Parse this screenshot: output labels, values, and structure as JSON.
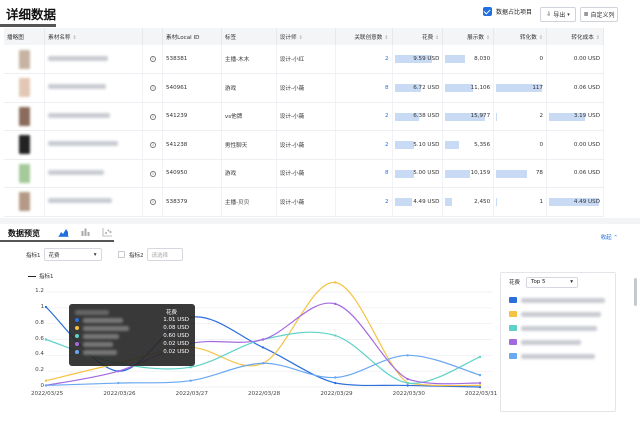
{
  "header": {
    "title": "详细数据"
  },
  "toolbar": {
    "toggle_label": "数据占比项目",
    "export_label": "导出",
    "custom_label": "自定义列"
  },
  "table": {
    "headers": [
      "播略图",
      "素材名称",
      "",
      "素材Local ID",
      "标签",
      "设计师",
      "关联创意数",
      "花费",
      "展示数",
      "转化数",
      "转化成本"
    ],
    "rows": [
      {
        "id": "538381",
        "tag": "主播-木木",
        "designer": "设计-小红",
        "creatives": "2",
        "cost": "9.59 USD",
        "impr": "8,030",
        "conv": "0",
        "cpa": "0.00 USD",
        "cost_frac": 0.85,
        "impr_frac": 0.45,
        "conv_frac": 0,
        "cpa_frac": 0,
        "thumb": "#c7b3a3"
      },
      {
        "id": "540961",
        "tag": "游戏",
        "designer": "设计-小薇",
        "creatives": "8",
        "cost": "6.72 USD",
        "impr": "11,106",
        "conv": "117",
        "cpa": "0.06 USD",
        "cost_frac": 0.6,
        "impr_frac": 0.62,
        "conv_frac": 1,
        "cpa_frac": 0,
        "thumb": "#e2c7b4"
      },
      {
        "id": "541239",
        "tag": "vs他牌",
        "designer": "设计-小薇",
        "creatives": "2",
        "cost": "6.38 USD",
        "impr": "15,977",
        "conv": "2",
        "cpa": "3.19 USD",
        "cost_frac": 0.56,
        "impr_frac": 0.9,
        "conv_frac": 0.02,
        "cpa_frac": 0.72,
        "thumb": "#8b6c5c"
      },
      {
        "id": "541238",
        "tag": "男性聊天",
        "designer": "设计-小薇",
        "creatives": "2",
        "cost": "5.10 USD",
        "impr": "5,356",
        "conv": "0",
        "cpa": "0.00 USD",
        "cost_frac": 0.45,
        "impr_frac": 0.3,
        "conv_frac": 0,
        "cpa_frac": 0,
        "thumb": "#222222"
      },
      {
        "id": "540950",
        "tag": "游戏",
        "designer": "设计-小薇",
        "creatives": "8",
        "cost": "5.00 USD",
        "impr": "10,159",
        "conv": "78",
        "cpa": "0.06 USD",
        "cost_frac": 0.44,
        "impr_frac": 0.57,
        "conv_frac": 0.67,
        "cpa_frac": 0,
        "thumb": "#a5c99a"
      },
      {
        "id": "538379",
        "tag": "主播-贝贝",
        "designer": "设计-小薇",
        "creatives": "2",
        "cost": "4.49 USD",
        "impr": "2,450",
        "conv": "1",
        "cpa": "4.49 USD",
        "cost_frac": 0.4,
        "impr_frac": 0.14,
        "conv_frac": 0.01,
        "cpa_frac": 1,
        "thumb": "#b49a86"
      }
    ]
  },
  "preview": {
    "title": "数据预览",
    "collapse_label": "收起",
    "metric1_label": "指标1",
    "metric1_value": "花费",
    "metric2_label": "指标2",
    "metric2_placeholder": "请选择",
    "legend_label": "指标1",
    "topn_label": "花费",
    "topn_value": "Top 5"
  },
  "tooltip": {
    "header": "花费",
    "rows": [
      {
        "value": "1.01 USD",
        "color": "#2a6fdb"
      },
      {
        "value": "0.08 USD",
        "color": "#f5c242"
      },
      {
        "value": "0.60 USD",
        "color": "#5fd2c8"
      },
      {
        "value": "0.02 USD",
        "color": "#a36ae0"
      },
      {
        "value": "0.02 USD",
        "color": "#6aa8f2"
      }
    ]
  },
  "chart_data": {
    "type": "line",
    "title": "",
    "x": [
      "2022/03/25",
      "2022/03/26",
      "2022/03/27",
      "2022/03/28",
      "2022/03/29",
      "2022/03/30",
      "2022/03/31"
    ],
    "yticks": [
      "0",
      "0.2",
      "0.4",
      "0.6",
      "0.8",
      "1",
      "1.2"
    ],
    "ylim": [
      0,
      1.2
    ],
    "series": [
      {
        "color": "#2a6fdb",
        "values": [
          1.01,
          0.2,
          0.88,
          0.5,
          0.05,
          0.02,
          0.0
        ]
      },
      {
        "color": "#f5c242",
        "values": [
          0.08,
          0.3,
          0.5,
          0.3,
          1.32,
          0.05,
          0.02
        ]
      },
      {
        "color": "#5fd2c8",
        "values": [
          0.6,
          0.3,
          0.25,
          0.6,
          0.65,
          0.05,
          0.38
        ]
      },
      {
        "color": "#a36ae0",
        "values": [
          0.02,
          0.2,
          0.55,
          0.6,
          1.05,
          0.1,
          0.05
        ]
      },
      {
        "color": "#6aa8f2",
        "values": [
          0.02,
          0.05,
          0.08,
          0.3,
          0.12,
          0.4,
          0.15
        ]
      }
    ]
  },
  "right_legend": {
    "swatches": [
      "#2a6fdb",
      "#f5c242",
      "#5fd2c8",
      "#a36ae0",
      "#6aa8f2"
    ]
  }
}
